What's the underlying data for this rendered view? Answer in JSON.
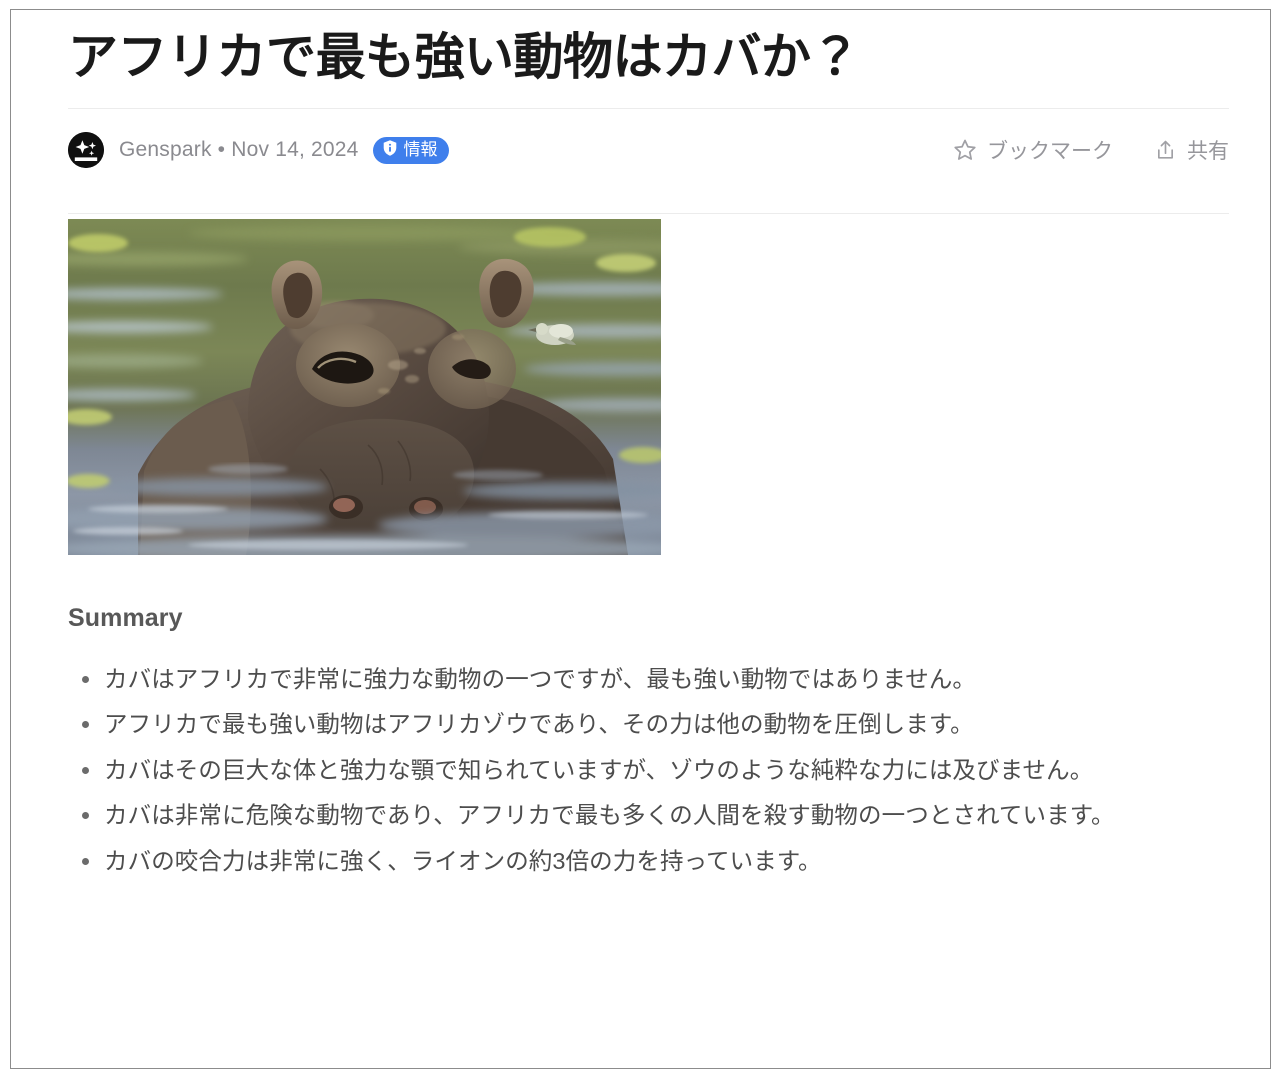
{
  "article": {
    "title": "アフリカで最も強い動物はカバか？",
    "meta": {
      "brand_logo_icon": "genspark-sparkle-logo",
      "author": "Genspark",
      "separator": "•",
      "date": "Nov 14, 2024",
      "badge": {
        "icon": "shield-info-icon",
        "label": "情報",
        "color": "#3f7fec"
      }
    },
    "actions": {
      "bookmark": {
        "icon": "star-outline-icon",
        "label": "ブックマーク"
      },
      "share": {
        "icon": "share-upload-icon",
        "label": "共有"
      }
    },
    "hero_image": {
      "icon": "hippopotamus-in-water-photo",
      "alt": "水中のカバ"
    },
    "summary": {
      "heading": "Summary",
      "bullets": [
        "カバはアフリカで非常に強力な動物の一つですが、最も強い動物ではありません。",
        "アフリカで最も強い動物はアフリカゾウであり、その力は他の動物を圧倒します。",
        "カバはその巨大な体と強力な顎で知られていますが、ゾウのような純粋な力には及びません。",
        "カバは非常に危険な動物であり、アフリカで最も多くの人間を殺す動物の一つとされています。",
        "カバの咬合力は非常に強く、ライオンの約3倍の力を持っています。"
      ]
    }
  },
  "theme": {
    "accent": "#3f7fec",
    "text_primary": "#1a1a1a",
    "text_muted": "#8a8a8f",
    "text_body": "#4d4d4d",
    "divider": "#ececec",
    "frame_border": "#8c8c8c"
  }
}
